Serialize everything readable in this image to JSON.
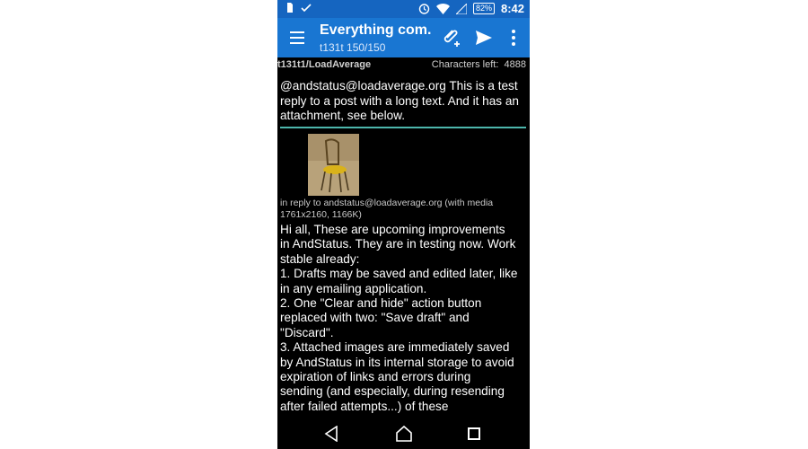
{
  "status_bar": {
    "battery": "82%",
    "time": "8:42"
  },
  "toolbar": {
    "title": "Everything com...",
    "subtitle": "t131t 150/150"
  },
  "compose": {
    "account": "t131t1/LoadAverage",
    "chars_left_label": "Characters left:",
    "chars_left_value": "4888",
    "text": "@andstatus@loadaverage.org This is a test reply to a post with a long text. And it has an attachment, see below."
  },
  "reply": {
    "info_line1": "in reply to andstatus@loadaverage.org (with media",
    "info_line2": "1761x2160, 1166K)",
    "body_lines": [
      "Hi all, These are upcoming improvements",
      "in AndStatus. They are in testing now. Work",
      "stable already:",
      "1. Drafts may be saved and edited later, like",
      "in any emailing application.",
      "2. One \"Clear and hide\" action button",
      "replaced with two: \"Save draft\" and",
      "\"Discard\".",
      "3. Attached images are immediately saved",
      "by AndStatus in its internal storage to avoid",
      "expiration of links and errors during",
      "sending (and especially, during resending",
      "after failed attempts...) of these"
    ]
  },
  "colors": {
    "toolbar": "#1976d2",
    "status_bar": "#1565c0",
    "accent": "#4db6ac"
  }
}
